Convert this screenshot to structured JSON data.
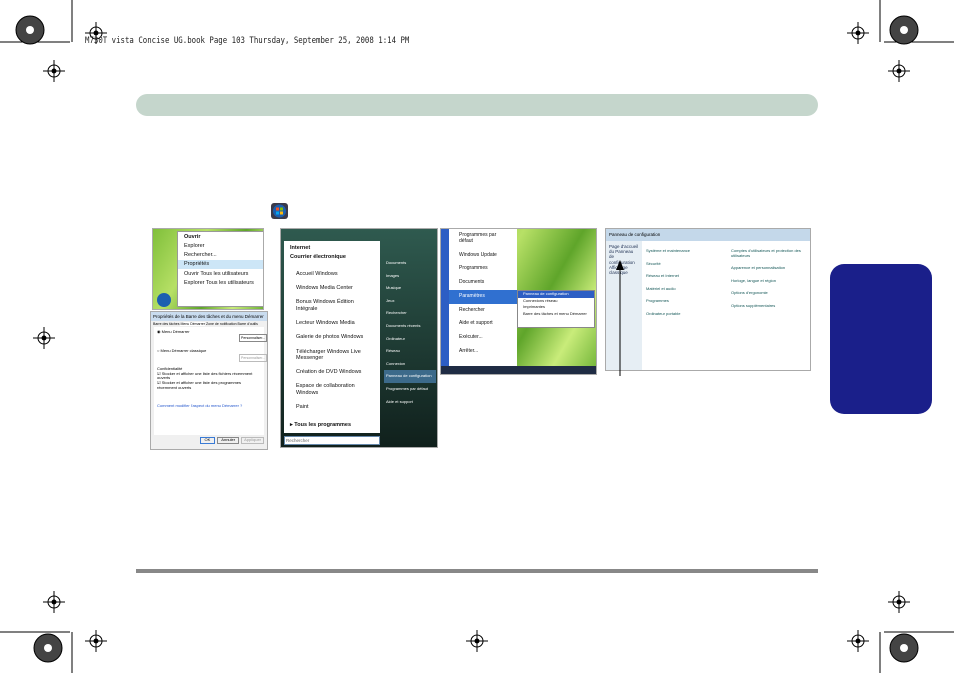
{
  "header": {
    "text": "M730T vista Concise UG.book  Page 103  Thursday, September 25, 2008  1:14 PM"
  },
  "panel1": {
    "items": [
      "Ouvrir",
      "Explorer",
      "Rechercher...",
      "Propriétés",
      "Ouvrir Tous les utilisateurs",
      "Explorer Tous les utilisateurs"
    ]
  },
  "panel2": {
    "title": "Propriétés de la Barre des tâches et du menu Démarrer",
    "tabs": [
      "Barre des tâches",
      "Menu Démarrer",
      "Zone de notification",
      "Barre d'outils"
    ],
    "opt1": "Menu Démarrer",
    "opt2": "Menu Démarrer classique",
    "btn1": "Personnaliser...",
    "btn2": "Personnaliser...",
    "privacy": "Confidentialité",
    "chk1": "Stocker et afficher une liste des fichiers récemment ouverts",
    "chk2": "Stocker et afficher une liste des programmes récemment ouverts",
    "link": "Comment modifier l'aspect du menu Démarrer ?",
    "ok": "OK",
    "cancel": "Annuler",
    "apply": "Appliquer"
  },
  "panel3": {
    "left": [
      "Internet",
      "Courrier électronique",
      "Accueil Windows",
      "Windows Media Center",
      "Bonus Windows Édition Intégrale",
      "Lecteur Windows Media",
      "Galerie de photos Windows",
      "Télécharger Windows Live Messenger",
      "Création de DVD Windows",
      "Espace de collaboration Windows",
      "Paint"
    ],
    "all_programs": "Tous les programmes",
    "search": "Rechercher",
    "right": [
      "Documents",
      "Images",
      "Musique",
      "Jeux",
      "Rechercher",
      "Documents récents",
      "Ordinateur",
      "Réseau",
      "Connexion",
      "Panneau de configuration",
      "Programmes par défaut",
      "Aide et support"
    ]
  },
  "panel4": {
    "items": [
      "Programmes par défaut",
      "Windows Update",
      "Programmes",
      "Documents",
      "Paramètres",
      "Rechercher",
      "Aide et support",
      "Exécuter...",
      "Arrêter..."
    ],
    "sub": [
      "Panneau de configuration",
      "Connexions réseau",
      "Imprimantes",
      "Barre des tâches et menu Démarrer"
    ],
    "brand": "Windows Vista"
  },
  "panel5": {
    "title": "Panneau de configuration",
    "left": [
      "Page d'accueil du Panneau de configuration",
      "Affichage classique"
    ],
    "cats": [
      "Système et maintenance",
      "Sécurité",
      "Réseau et Internet",
      "Matériel et audio",
      "Programmes",
      "Ordinateur portable",
      "Comptes d'utilisateurs et protection des utilisateurs",
      "Apparence et personnalisation",
      "Horloge, langue et région",
      "Options d'ergonomie",
      "Options supplémentaires"
    ]
  }
}
